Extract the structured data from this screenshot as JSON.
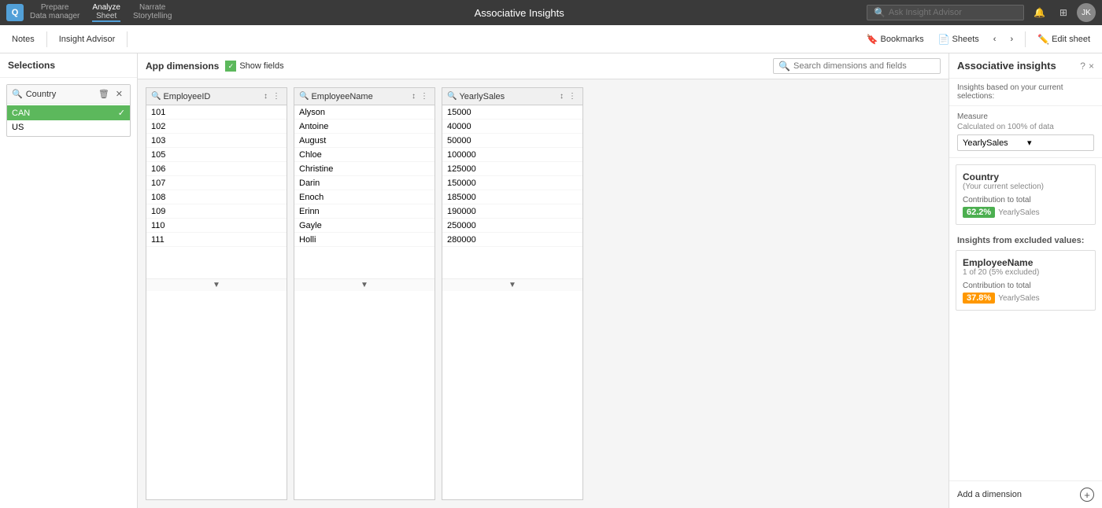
{
  "app": {
    "title": "Associative Insights",
    "logo_text": "Q"
  },
  "topbar": {
    "prepare_label": "Prepare",
    "prepare_sub": "Data manager",
    "analyze_label": "Analyze",
    "analyze_sub": "Sheet",
    "narrate_label": "Narrate",
    "narrate_sub": "Storytelling",
    "ask_placeholder": "Ask Insight Advisor",
    "notifications_icon": "🔔",
    "apps_icon": "⊞",
    "avatar_initials": "JK"
  },
  "toolbar": {
    "notes_label": "Notes",
    "insight_advisor_label": "Insight Advisor",
    "smart_search_icon": "⌕",
    "bookmarks_label": "Bookmarks",
    "sheets_label": "Sheets",
    "back_icon": "‹",
    "forward_icon": "›",
    "edit_sheet_label": "Edit sheet",
    "pencil_icon": "✎"
  },
  "selections": {
    "header": "Selections",
    "items": [
      {
        "field": "Country",
        "options": [
          {
            "value": "CAN",
            "selected": true
          },
          {
            "value": "US",
            "selected": false
          }
        ]
      }
    ]
  },
  "app_dimensions": {
    "label": "App dimensions",
    "show_fields_label": "Show fields",
    "show_fields_checked": true,
    "search_placeholder": "Search dimensions and fields",
    "tables": [
      {
        "title": "EmployeeID",
        "rows": [
          "101",
          "102",
          "103",
          "105",
          "106",
          "107",
          "108",
          "109",
          "110",
          "111"
        ]
      },
      {
        "title": "EmployeeName",
        "rows": [
          "Alyson",
          "Antoine",
          "August",
          "Chloe",
          "Christine",
          "Darin",
          "Enoch",
          "Erinn",
          "Gayle",
          "Holli"
        ]
      },
      {
        "title": "YearlySales",
        "rows": [
          "15000",
          "40000",
          "50000",
          "100000",
          "125000",
          "150000",
          "185000",
          "190000",
          "250000",
          "280000"
        ]
      }
    ]
  },
  "associative_insights": {
    "title": "Associative insights",
    "help_icon": "?",
    "close_icon": "×",
    "based_on_text": "Insights based on your current selections:",
    "measure": {
      "label": "Measure",
      "calc_label": "Calculated on 100% of data",
      "selected": "YearlySales"
    },
    "current_selection_card": {
      "title": "Country",
      "subtitle": "(Your current selection)",
      "contribution_label": "Contribution to total",
      "percent": "62.2%",
      "percent_color": "green",
      "measure": "YearlySales"
    },
    "excluded_label": "Insights from excluded values:",
    "excluded_card": {
      "title": "EmployeeName",
      "subtitle": "1 of 20 (5% excluded)",
      "contribution_label": "Contribution to total",
      "percent": "37.8%",
      "percent_color": "orange",
      "measure": "YearlySales"
    },
    "add_dimension_label": "Add a dimension"
  },
  "colors": {
    "green": "#4caf50",
    "orange": "#ff9800",
    "selected_bg": "#5cb85c",
    "accent_blue": "#52a0d8"
  }
}
